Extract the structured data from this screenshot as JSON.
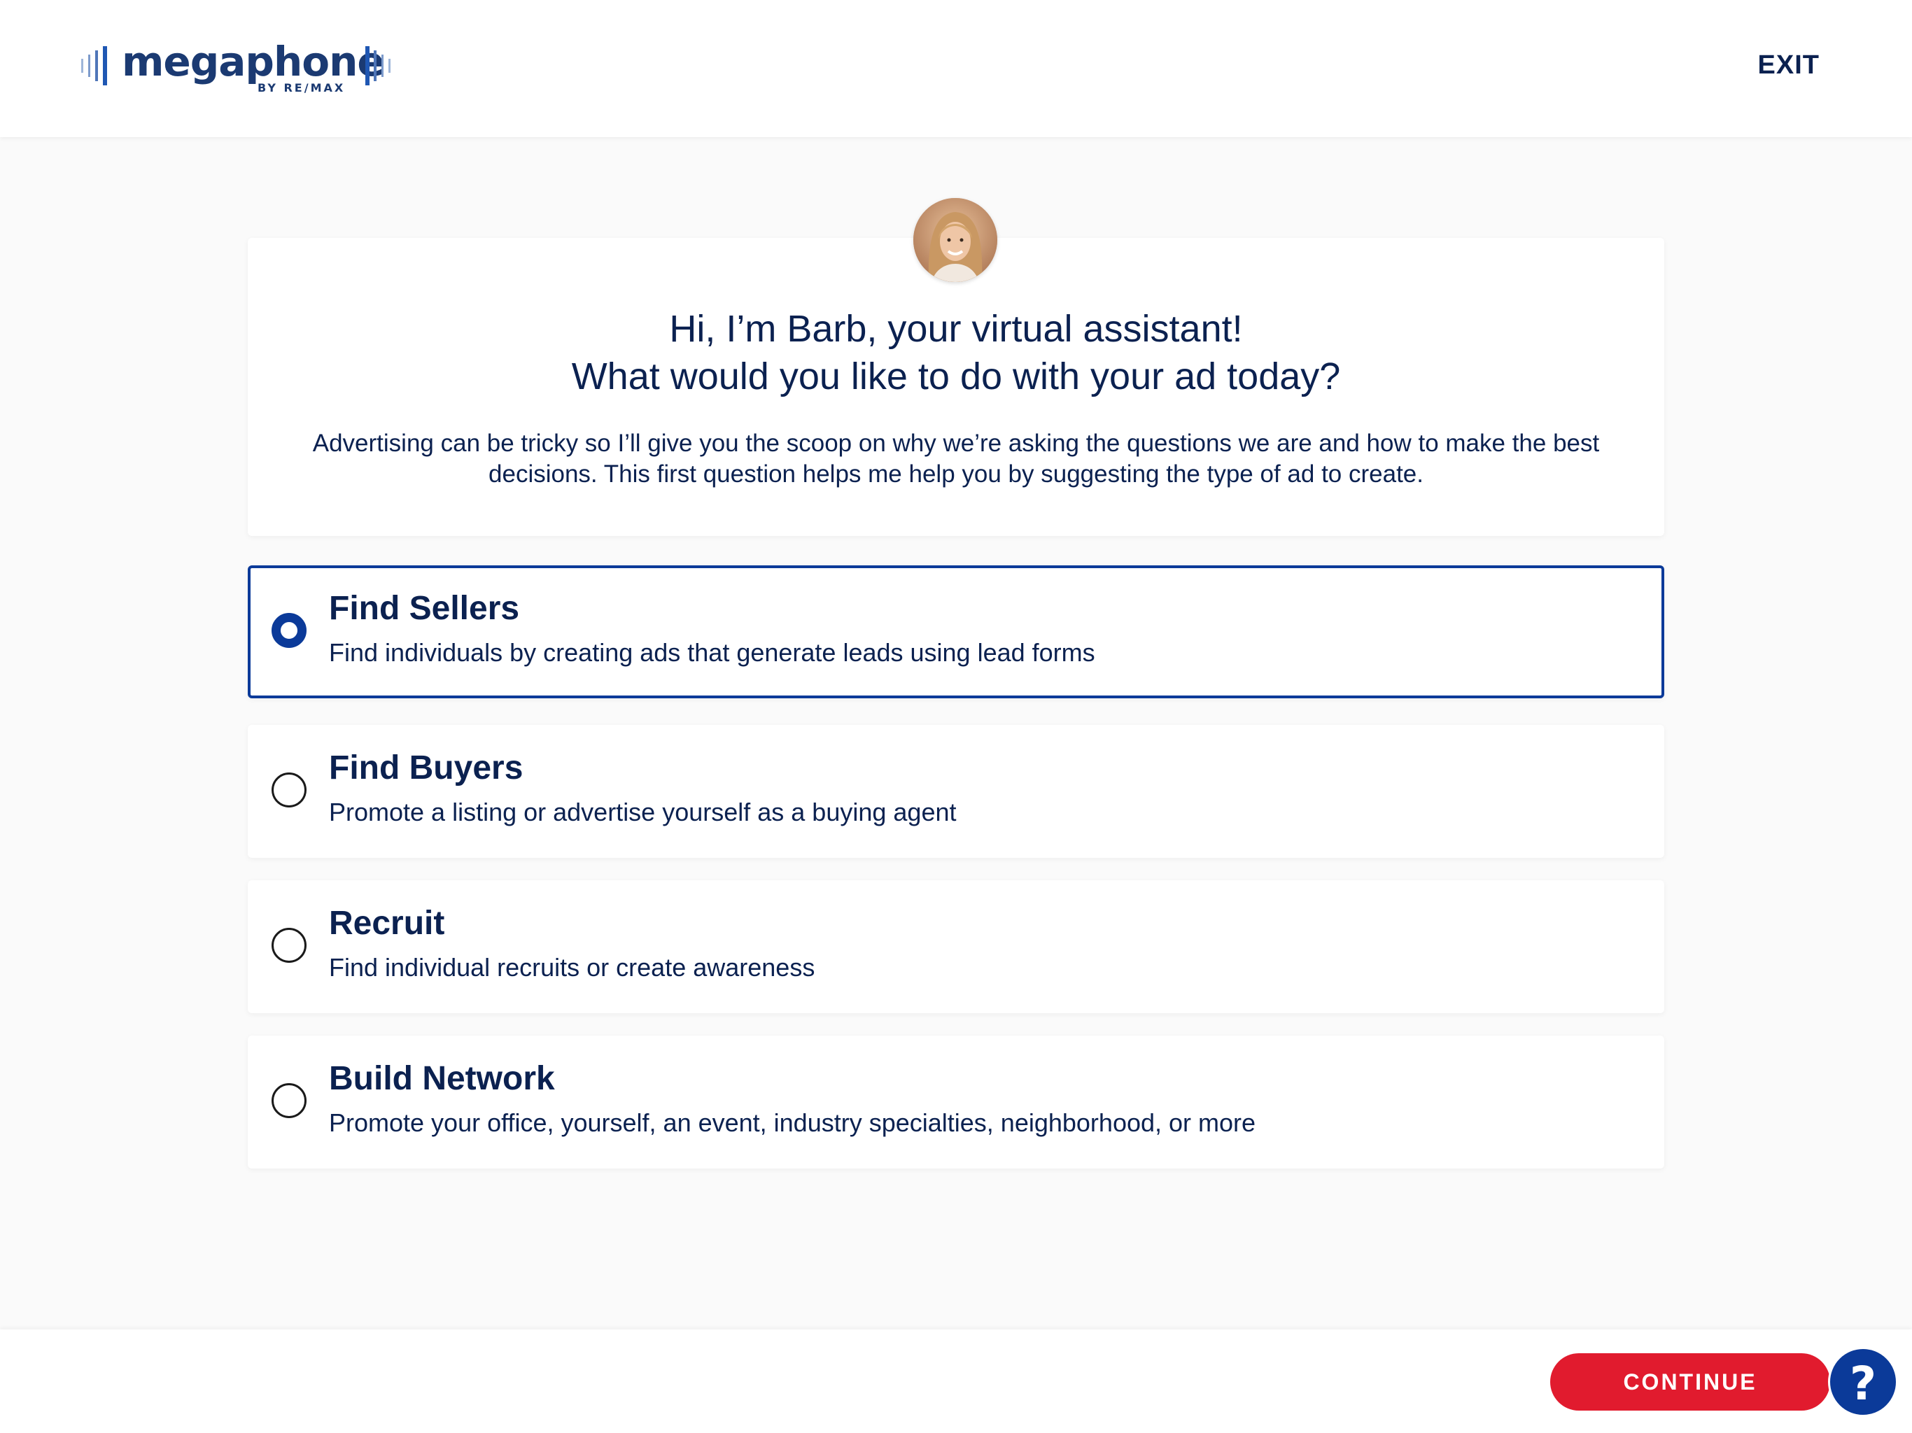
{
  "header": {
    "logo_word": "megaphone",
    "logo_sub": "BY RE/MAX",
    "exit_label": "EXIT"
  },
  "intro": {
    "greeting_line1": "Hi, I’m Barb, your virtual assistant!",
    "greeting_line2": "What would you like to do with your ad today?",
    "description": "Advertising can be tricky so I’ll give you the scoop on why we’re asking the questions we are and how to make the best decisions. This first question helps me help you by suggesting the type of ad to create."
  },
  "options": [
    {
      "title": "Find Sellers",
      "subtitle": "Find individuals by creating ads that generate leads using lead forms",
      "selected": true
    },
    {
      "title": "Find Buyers",
      "subtitle": "Promote a listing or advertise yourself as a buying agent",
      "selected": false
    },
    {
      "title": "Recruit",
      "subtitle": "Find individual recruits or create awareness",
      "selected": false
    },
    {
      "title": "Build Network",
      "subtitle": "Promote your office, yourself, an event, industry specialties, neighborhood, or more",
      "selected": false
    }
  ],
  "footer": {
    "continue_label": "CONTINUE",
    "help_label": "?"
  },
  "colors": {
    "brand_navy": "#0b2150",
    "accent_blue": "#0b3a99",
    "continue_red": "#e11b2e"
  }
}
